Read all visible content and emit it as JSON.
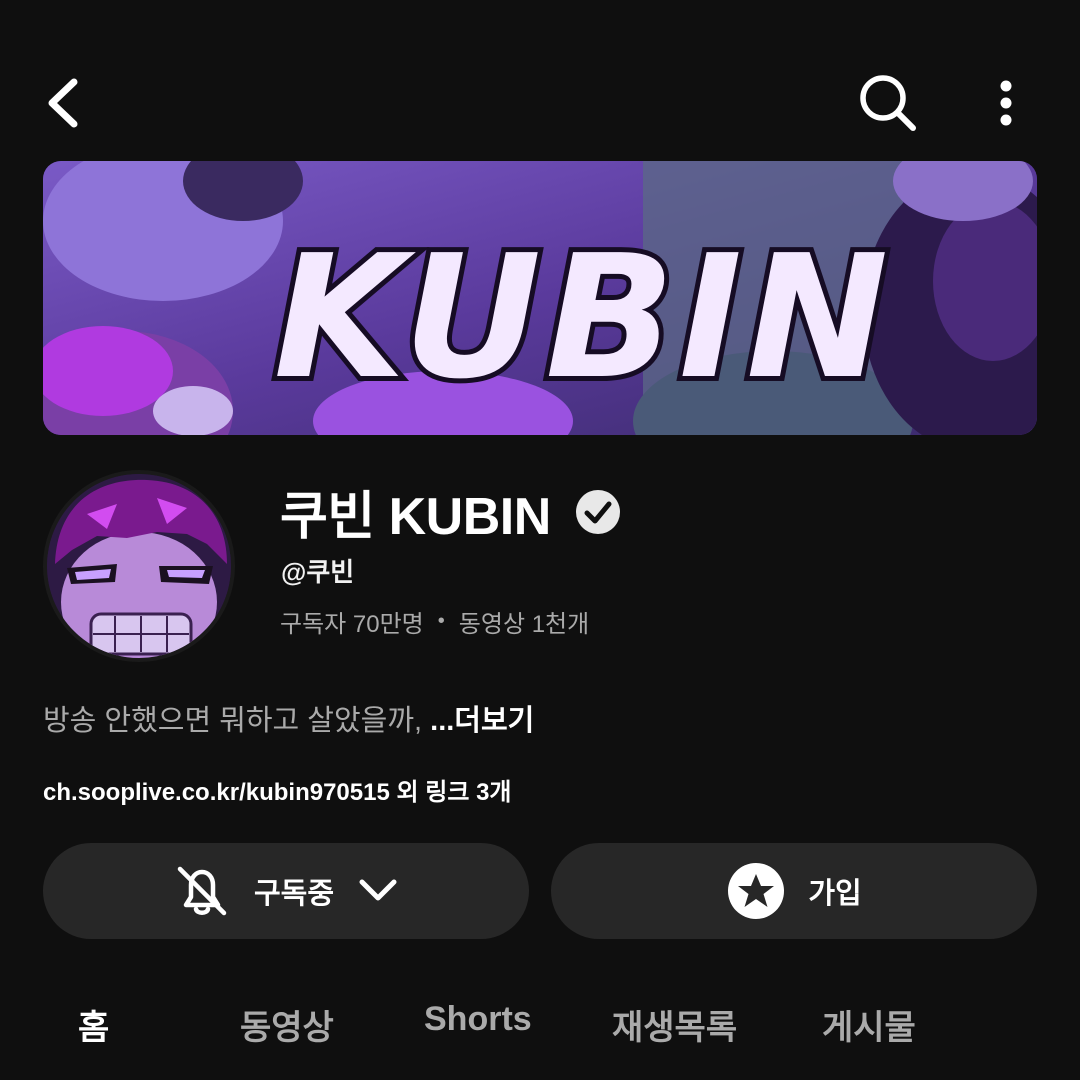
{
  "header": {
    "back_icon": "chevron-left-icon",
    "search_icon": "search-icon",
    "more_icon": "more-vertical-icon"
  },
  "banner": {
    "logo_text": "KUBIN",
    "colors": {
      "primary": "#6b3fb0",
      "accent": "#d75cff",
      "logo_fill": "#f4e9ff"
    }
  },
  "channel": {
    "name": "쿠빈 KUBIN",
    "verified_icon": "verified-check-icon",
    "handle": "@쿠빈",
    "subscribers": "구독자 70만명",
    "separator": "•",
    "videos": "동영상 1천개",
    "description": "방송 안했으면 뭐하고 살았을까,",
    "more_label": "...더보기",
    "link": "ch.sooplive.co.kr/kubin970515",
    "link_extra": "외 링크 3개"
  },
  "actions": {
    "subscribe_label": "구독중",
    "subscribe_icon": "bell-off-icon",
    "dropdown_icon": "chevron-down-icon",
    "join_label": "가입",
    "join_icon": "star-badge-icon"
  },
  "tabs": [
    {
      "label": "홈",
      "active": true
    },
    {
      "label": "동영상",
      "active": false
    },
    {
      "label": "Shorts",
      "active": false
    },
    {
      "label": "재생목록",
      "active": false
    },
    {
      "label": "게시물",
      "active": false
    }
  ]
}
